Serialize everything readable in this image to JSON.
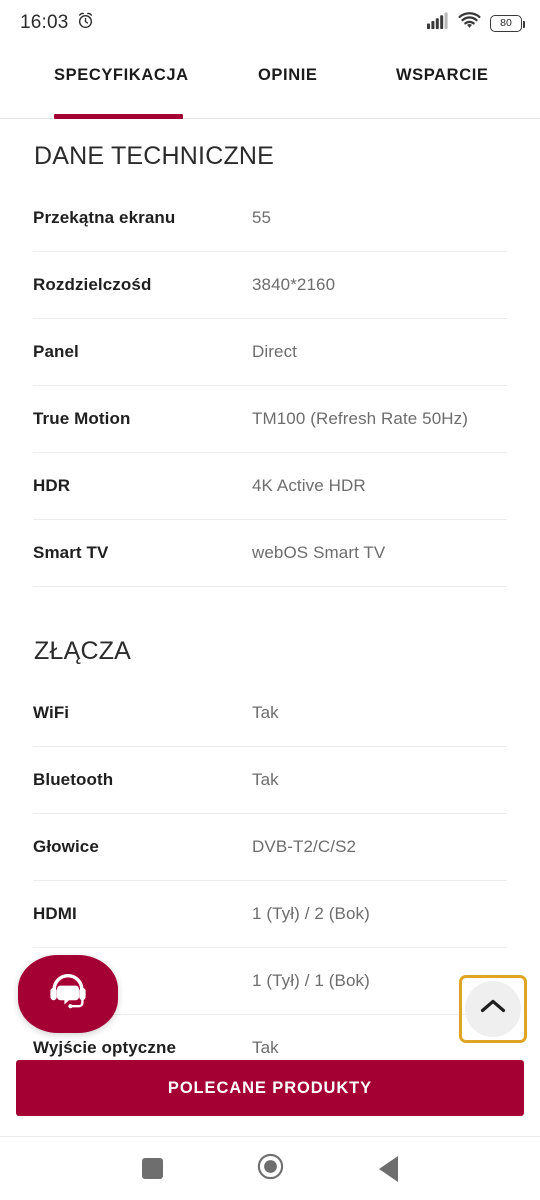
{
  "status_bar": {
    "time": "16:03",
    "alarm_icon": "alarm-clock-icon",
    "signal_icon": "cellular-signal-icon",
    "wifi_icon": "wifi-icon",
    "battery_level": "80",
    "battery_icon": "battery-icon"
  },
  "tabs": [
    {
      "label": "SPECYFIKACJA",
      "active": true
    },
    {
      "label": "OPINIE",
      "active": false
    },
    {
      "label": "WSPARCIE",
      "active": false
    }
  ],
  "accent_color": "#a50034",
  "focus_ring_color": "#e0a424",
  "sections": [
    {
      "title": "DANE TECHNICZNE",
      "rows": [
        {
          "label": "Przekątna ekranu",
          "value": "55"
        },
        {
          "label": "Rozdzielczośd",
          "value": "3840*2160"
        },
        {
          "label": "Panel",
          "value": "Direct"
        },
        {
          "label": "True Motion",
          "value": "TM100 (Refresh Rate 50Hz)"
        },
        {
          "label": "HDR",
          "value": "4K Active HDR"
        },
        {
          "label": "Smart TV",
          "value": "webOS Smart TV"
        }
      ]
    },
    {
      "title": "ZŁĄCZA",
      "rows": [
        {
          "label": "WiFi",
          "value": "Tak"
        },
        {
          "label": "Bluetooth",
          "value": "Tak"
        },
        {
          "label": "Głowice",
          "value": "DVB-T2/C/S2"
        },
        {
          "label": "HDMI",
          "value": "1 (Tył) / 2 (Bok)"
        },
        {
          "label": "",
          "value": "1 (Tył) / 1 (Bok)"
        },
        {
          "label": "Wyjście optyczne",
          "value": "Tak"
        }
      ]
    }
  ],
  "chat_widget": {
    "icon": "headset-support-icon",
    "color": "#a50034"
  },
  "scroll_top_button": {
    "icon": "chevron-up-icon"
  },
  "cta_button": {
    "label": "POLECANE PRODUKTY"
  },
  "system_nav": {
    "recents_icon": "square-recents-icon",
    "home_icon": "circle-home-icon",
    "back_icon": "triangle-back-icon"
  }
}
